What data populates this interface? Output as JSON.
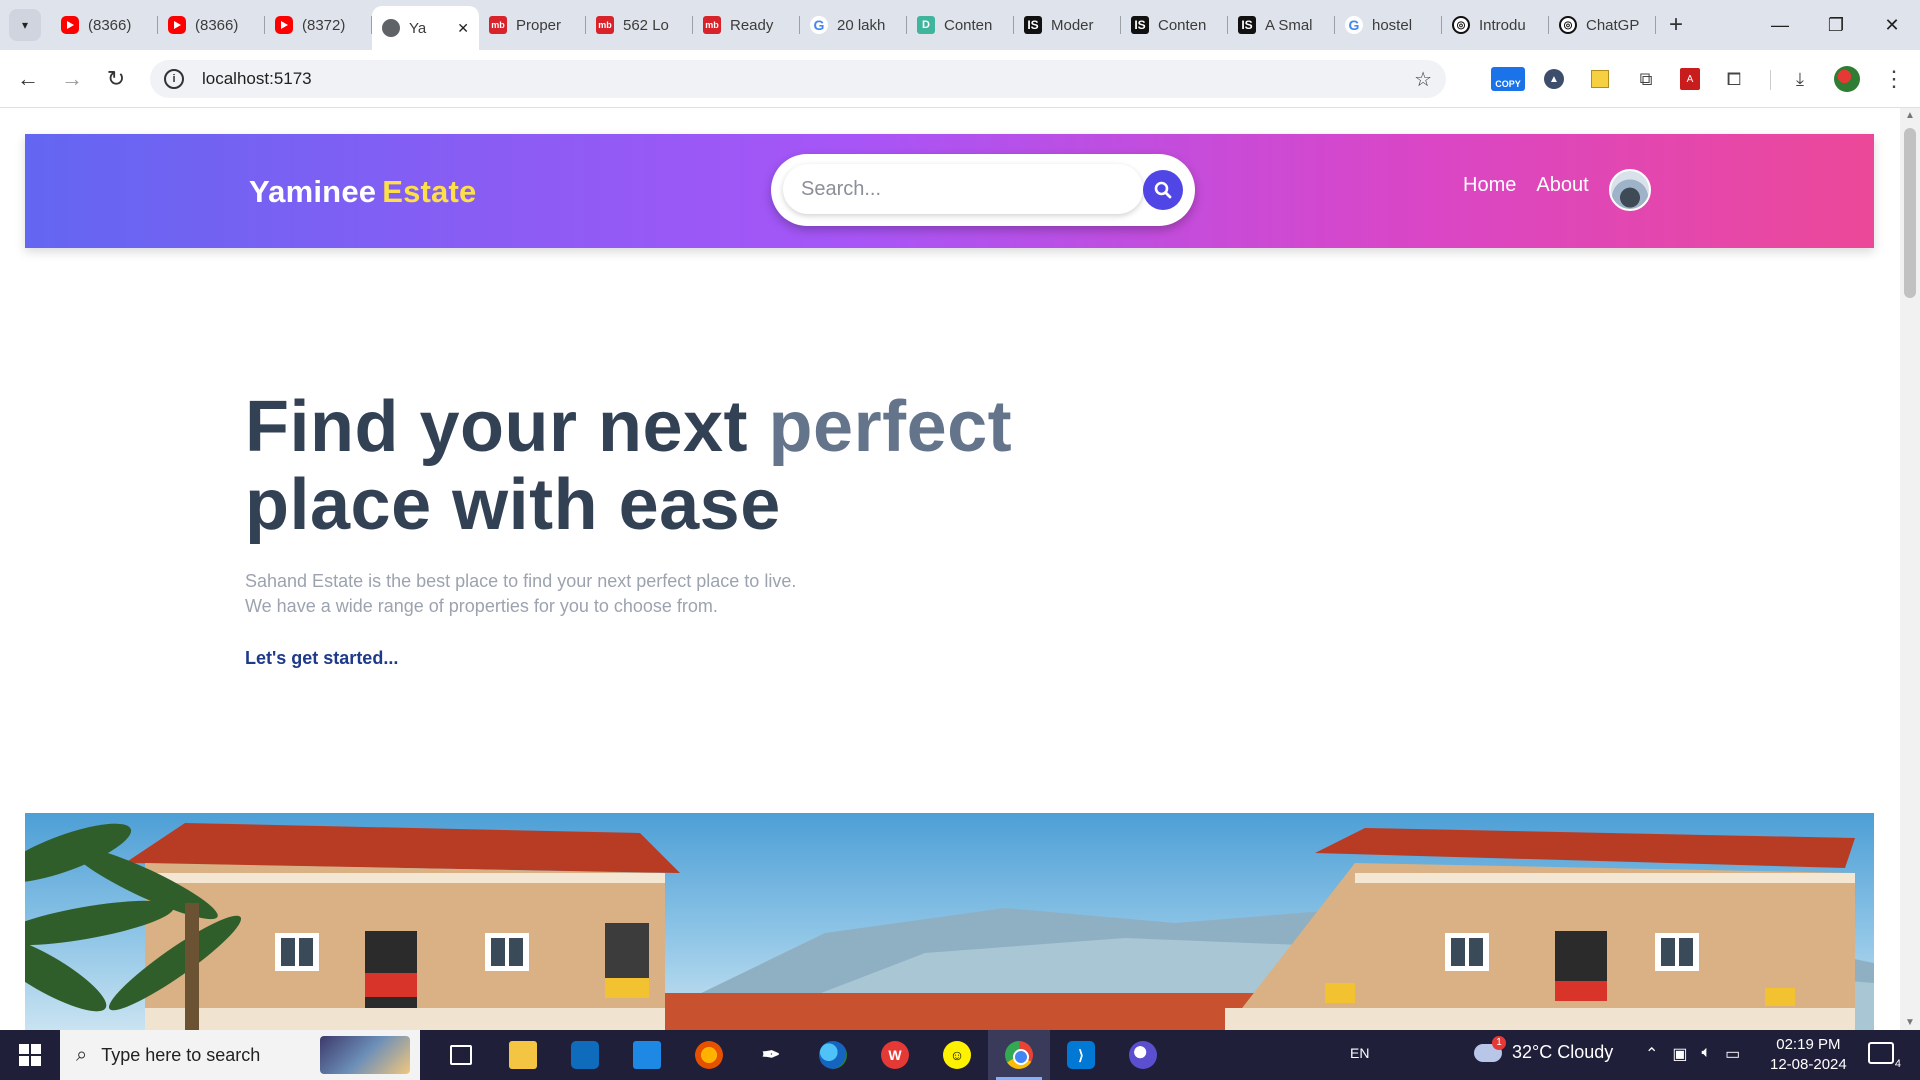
{
  "browser": {
    "tabs": [
      {
        "label": "(8366)",
        "favicon": "youtube-icon",
        "kind": "yt"
      },
      {
        "label": "(8366)",
        "favicon": "youtube-icon",
        "kind": "yt"
      },
      {
        "label": "(8372)",
        "favicon": "youtube-icon",
        "kind": "yt"
      },
      {
        "label": "Ya",
        "favicon": "globe-icon",
        "kind": "globe",
        "active": true
      },
      {
        "label": "Proper",
        "favicon": "magicbricks-icon",
        "kind": "mb",
        "glyph": "mb"
      },
      {
        "label": "562 Lo",
        "favicon": "magicbricks-icon",
        "kind": "mb",
        "glyph": "mb"
      },
      {
        "label": "Ready",
        "favicon": "magicbricks-icon",
        "kind": "mb",
        "glyph": "mb"
      },
      {
        "label": "20 lakh",
        "favicon": "google-icon",
        "kind": "g",
        "glyph": "G"
      },
      {
        "label": "Conten",
        "favicon": "document-icon",
        "kind": "d",
        "glyph": "D"
      },
      {
        "label": "Moder",
        "favicon": "is-icon",
        "kind": "is",
        "glyph": "IS"
      },
      {
        "label": "Conten",
        "favicon": "is-icon",
        "kind": "is",
        "glyph": "IS"
      },
      {
        "label": "A Smal",
        "favicon": "is-icon",
        "kind": "is",
        "glyph": "IS"
      },
      {
        "label": "hostel",
        "favicon": "google-icon",
        "kind": "g",
        "glyph": "G"
      },
      {
        "label": "Introdu",
        "favicon": "openai-icon",
        "kind": "gpt",
        "glyph": "◎"
      },
      {
        "label": "ChatGP",
        "favicon": "openai-icon",
        "kind": "gpt",
        "glyph": "◎"
      }
    ],
    "url": "localhost:5173",
    "copy_ext_label": "COPY"
  },
  "site": {
    "logo_part1": "Yaminee",
    "logo_part2": "Estate",
    "search_placeholder": "Search...",
    "nav": [
      "Home",
      "About"
    ],
    "colors": {
      "gradient_start": "#6366f1",
      "gradient_end": "#ec4899",
      "logo_accent": "#fde047",
      "search_button": "#4f46e5"
    }
  },
  "hero": {
    "title_part1": "Find your next",
    "title_accent": "perfect",
    "title_part2": "place with ease",
    "sub_line1": "Sahand Estate is the best place to find your next perfect place to live.",
    "sub_line2": "We have a wide range of properties for you to choose from.",
    "cta": "Let's get started..."
  },
  "taskbar": {
    "search_placeholder": "Type here to search",
    "language": "EN",
    "weather": "32°C  Cloudy",
    "weather_badge": "1",
    "time": "02:19 PM",
    "date": "12-08-2024",
    "notification_count": "4"
  }
}
